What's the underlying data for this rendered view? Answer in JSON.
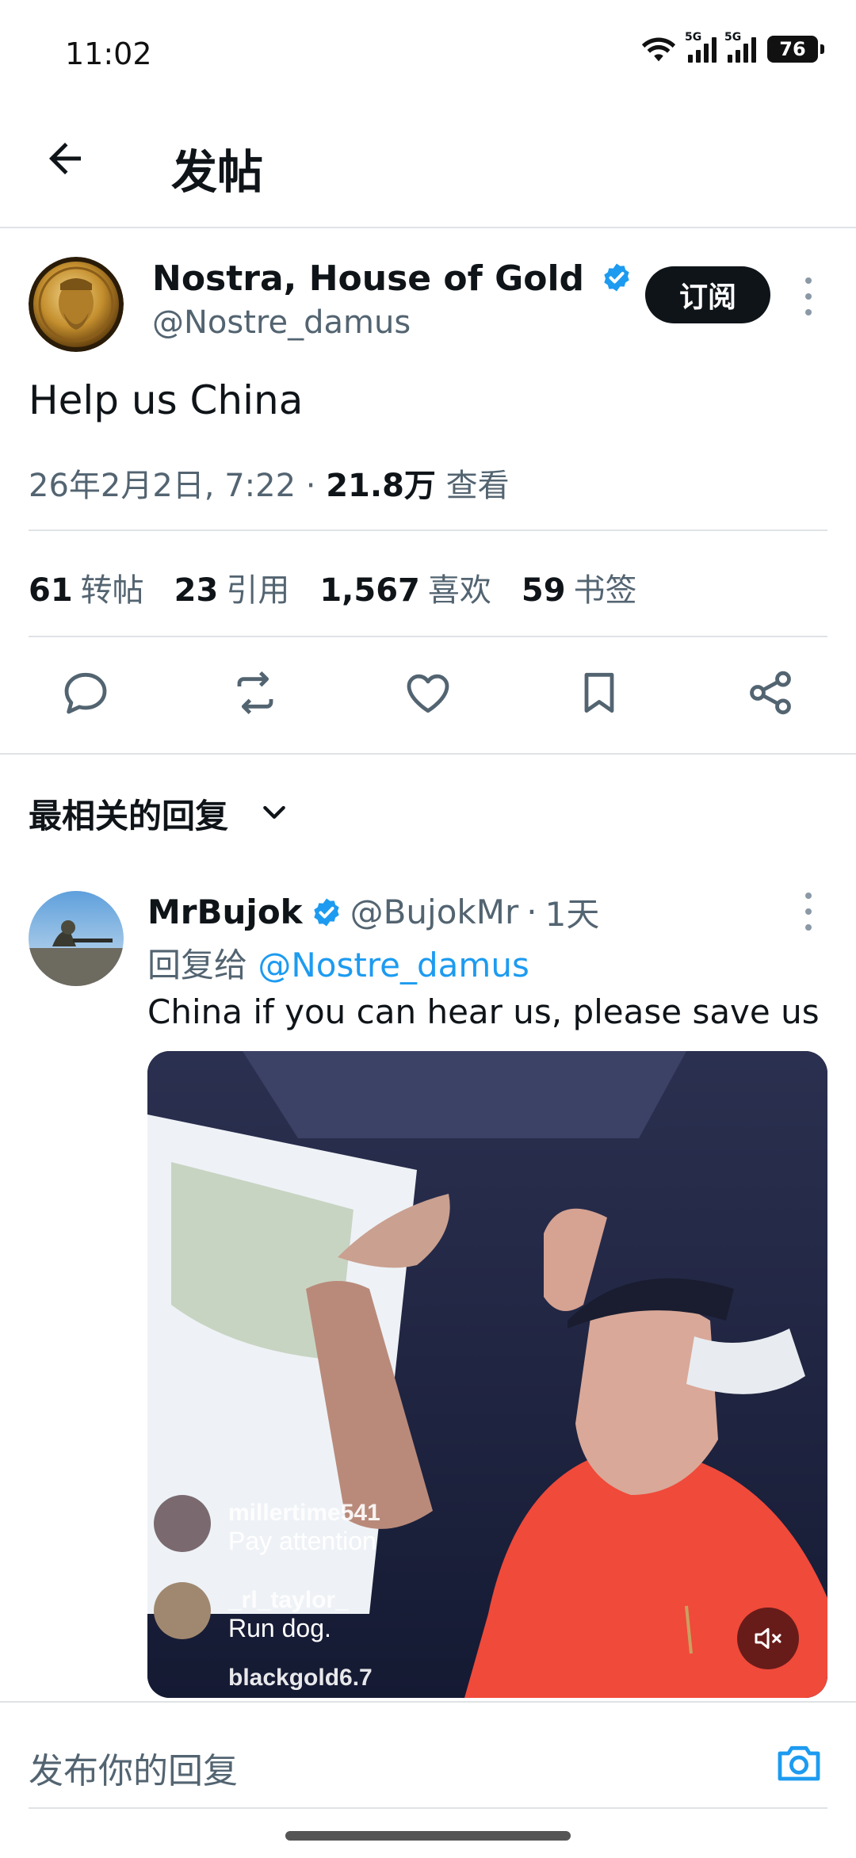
{
  "status_bar": {
    "time": "11:02",
    "network_1": "5G",
    "network_2": "5G",
    "battery": "76"
  },
  "header": {
    "title": "发帖"
  },
  "post": {
    "author_name": "Nostra, House of Gold",
    "author_handle": "@Nostre_damus",
    "subscribe_label": "订阅",
    "text": "Help us China",
    "timestamp": "26年2月2日, 7:22",
    "views_count": "21.8万",
    "views_label": "查看"
  },
  "stats": [
    {
      "count": "61",
      "label": "转帖"
    },
    {
      "count": "23",
      "label": "引用"
    },
    {
      "count": "1,567",
      "label": "喜欢"
    },
    {
      "count": "59",
      "label": "书签"
    }
  ],
  "actions": [
    "reply-icon",
    "repost-icon",
    "like-icon",
    "bookmark-icon",
    "share-icon"
  ],
  "replies_section": {
    "title": "最相关的回复"
  },
  "reply": {
    "name": "MrBujok",
    "handle": "@BujokMr",
    "time": "1天",
    "reply_to_label": "回复给",
    "reply_to_handle": "@Nostre_damus",
    "text": "China if you can hear us, please save us",
    "video_overlay": [
      {
        "user": "millertime541",
        "message": "Pay attention"
      },
      {
        "user": "_rl_taylor_",
        "message": "Run dog."
      },
      {
        "user": "blackgold6.7",
        "message": ""
      }
    ]
  },
  "composer": {
    "placeholder": "发布你的回复"
  },
  "colors": {
    "accent": "#1d9bf0",
    "text": "#0f1419",
    "secondary": "#536471"
  }
}
